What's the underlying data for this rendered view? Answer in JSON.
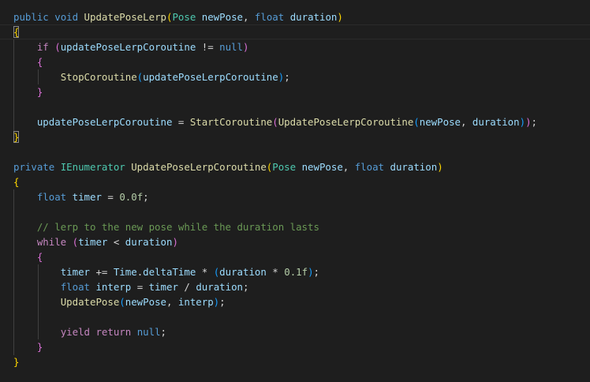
{
  "colors": {
    "background": "#1e1e1e",
    "keyword": "#569cd6",
    "control": "#c586c0",
    "function": "#dcdcaa",
    "type": "#4ec9b0",
    "variable": "#9cdcfe",
    "number": "#b5cea8",
    "comment": "#6a9955",
    "plain": "#d4d4d4",
    "bracket_level1": "#ffd700",
    "bracket_level2": "#da70d6",
    "bracket_level3": "#179fff"
  },
  "lines": [
    [
      {
        "t": "public",
        "c": "kw"
      },
      {
        "t": " ",
        "c": "pl"
      },
      {
        "t": "void",
        "c": "kw"
      },
      {
        "t": " ",
        "c": "pl"
      },
      {
        "t": "UpdatePoseLerp",
        "c": "fn"
      },
      {
        "t": "(",
        "c": "b1"
      },
      {
        "t": "Pose",
        "c": "ty"
      },
      {
        "t": " ",
        "c": "pl"
      },
      {
        "t": "newPose",
        "c": "var"
      },
      {
        "t": ", ",
        "c": "pl"
      },
      {
        "t": "float",
        "c": "kw"
      },
      {
        "t": " ",
        "c": "pl"
      },
      {
        "t": "duration",
        "c": "var"
      },
      {
        "t": ")",
        "c": "b1"
      }
    ],
    [
      {
        "t": "{",
        "c": "b1",
        "box": true
      }
    ],
    [
      {
        "t": "    ",
        "c": "pl"
      },
      {
        "t": "if",
        "c": "ctrl"
      },
      {
        "t": " ",
        "c": "pl"
      },
      {
        "t": "(",
        "c": "b2"
      },
      {
        "t": "updatePoseLerpCoroutine",
        "c": "var"
      },
      {
        "t": " != ",
        "c": "pl"
      },
      {
        "t": "null",
        "c": "kw"
      },
      {
        "t": ")",
        "c": "b2"
      }
    ],
    [
      {
        "t": "    ",
        "c": "pl"
      },
      {
        "t": "{",
        "c": "b2"
      }
    ],
    [
      {
        "t": "        ",
        "c": "pl"
      },
      {
        "t": "StopCoroutine",
        "c": "fn"
      },
      {
        "t": "(",
        "c": "b3"
      },
      {
        "t": "updatePoseLerpCoroutine",
        "c": "var"
      },
      {
        "t": ")",
        "c": "b3"
      },
      {
        "t": ";",
        "c": "pl"
      }
    ],
    [
      {
        "t": "    ",
        "c": "pl"
      },
      {
        "t": "}",
        "c": "b2"
      }
    ],
    [],
    [
      {
        "t": "    ",
        "c": "pl"
      },
      {
        "t": "updatePoseLerpCoroutine",
        "c": "var"
      },
      {
        "t": " = ",
        "c": "pl"
      },
      {
        "t": "StartCoroutine",
        "c": "fn"
      },
      {
        "t": "(",
        "c": "b2"
      },
      {
        "t": "UpdatePoseLerpCoroutine",
        "c": "fn"
      },
      {
        "t": "(",
        "c": "b3"
      },
      {
        "t": "newPose",
        "c": "var"
      },
      {
        "t": ", ",
        "c": "pl"
      },
      {
        "t": "duration",
        "c": "var"
      },
      {
        "t": ")",
        "c": "b3"
      },
      {
        "t": ")",
        "c": "b2"
      },
      {
        "t": ";",
        "c": "pl"
      }
    ],
    [
      {
        "t": "}",
        "c": "b1",
        "box": true
      }
    ],
    [],
    [
      {
        "t": "private",
        "c": "kw"
      },
      {
        "t": " ",
        "c": "pl"
      },
      {
        "t": "IEnumerator",
        "c": "ty"
      },
      {
        "t": " ",
        "c": "pl"
      },
      {
        "t": "UpdatePoseLerpCoroutine",
        "c": "fn"
      },
      {
        "t": "(",
        "c": "b1"
      },
      {
        "t": "Pose",
        "c": "ty"
      },
      {
        "t": " ",
        "c": "pl"
      },
      {
        "t": "newPose",
        "c": "var"
      },
      {
        "t": ", ",
        "c": "pl"
      },
      {
        "t": "float",
        "c": "kw"
      },
      {
        "t": " ",
        "c": "pl"
      },
      {
        "t": "duration",
        "c": "var"
      },
      {
        "t": ")",
        "c": "b1"
      }
    ],
    [
      {
        "t": "{",
        "c": "b1"
      }
    ],
    [
      {
        "t": "    ",
        "c": "pl"
      },
      {
        "t": "float",
        "c": "kw"
      },
      {
        "t": " ",
        "c": "pl"
      },
      {
        "t": "timer",
        "c": "var"
      },
      {
        "t": " = ",
        "c": "pl"
      },
      {
        "t": "0.0f",
        "c": "num"
      },
      {
        "t": ";",
        "c": "pl"
      }
    ],
    [],
    [
      {
        "t": "    ",
        "c": "pl"
      },
      {
        "t": "// lerp to the new pose while the duration lasts",
        "c": "cm"
      }
    ],
    [
      {
        "t": "    ",
        "c": "pl"
      },
      {
        "t": "while",
        "c": "ctrl"
      },
      {
        "t": " ",
        "c": "pl"
      },
      {
        "t": "(",
        "c": "b2"
      },
      {
        "t": "timer",
        "c": "var"
      },
      {
        "t": " < ",
        "c": "pl"
      },
      {
        "t": "duration",
        "c": "var"
      },
      {
        "t": ")",
        "c": "b2"
      }
    ],
    [
      {
        "t": "    ",
        "c": "pl"
      },
      {
        "t": "{",
        "c": "b2"
      }
    ],
    [
      {
        "t": "        ",
        "c": "pl"
      },
      {
        "t": "timer",
        "c": "var"
      },
      {
        "t": " += ",
        "c": "pl"
      },
      {
        "t": "Time",
        "c": "var"
      },
      {
        "t": ".",
        "c": "pl"
      },
      {
        "t": "deltaTime",
        "c": "var"
      },
      {
        "t": " * ",
        "c": "pl"
      },
      {
        "t": "(",
        "c": "b3"
      },
      {
        "t": "duration",
        "c": "var"
      },
      {
        "t": " * ",
        "c": "pl"
      },
      {
        "t": "0.1f",
        "c": "num"
      },
      {
        "t": ")",
        "c": "b3"
      },
      {
        "t": ";",
        "c": "pl"
      }
    ],
    [
      {
        "t": "        ",
        "c": "pl"
      },
      {
        "t": "float",
        "c": "kw"
      },
      {
        "t": " ",
        "c": "pl"
      },
      {
        "t": "interp",
        "c": "var"
      },
      {
        "t": " = ",
        "c": "pl"
      },
      {
        "t": "timer",
        "c": "var"
      },
      {
        "t": " / ",
        "c": "pl"
      },
      {
        "t": "duration",
        "c": "var"
      },
      {
        "t": ";",
        "c": "pl"
      }
    ],
    [
      {
        "t": "        ",
        "c": "pl"
      },
      {
        "t": "UpdatePose",
        "c": "fn"
      },
      {
        "t": "(",
        "c": "b3"
      },
      {
        "t": "newPose",
        "c": "var"
      },
      {
        "t": ", ",
        "c": "pl"
      },
      {
        "t": "interp",
        "c": "var"
      },
      {
        "t": ")",
        "c": "b3"
      },
      {
        "t": ";",
        "c": "pl"
      }
    ],
    [],
    [
      {
        "t": "        ",
        "c": "pl"
      },
      {
        "t": "yield",
        "c": "ctrl"
      },
      {
        "t": " ",
        "c": "pl"
      },
      {
        "t": "return",
        "c": "ctrl"
      },
      {
        "t": " ",
        "c": "pl"
      },
      {
        "t": "null",
        "c": "kw"
      },
      {
        "t": ";",
        "c": "pl"
      }
    ],
    [
      {
        "t": "    ",
        "c": "pl"
      },
      {
        "t": "}",
        "c": "b2"
      }
    ],
    [
      {
        "t": "}",
        "c": "b1"
      }
    ]
  ]
}
